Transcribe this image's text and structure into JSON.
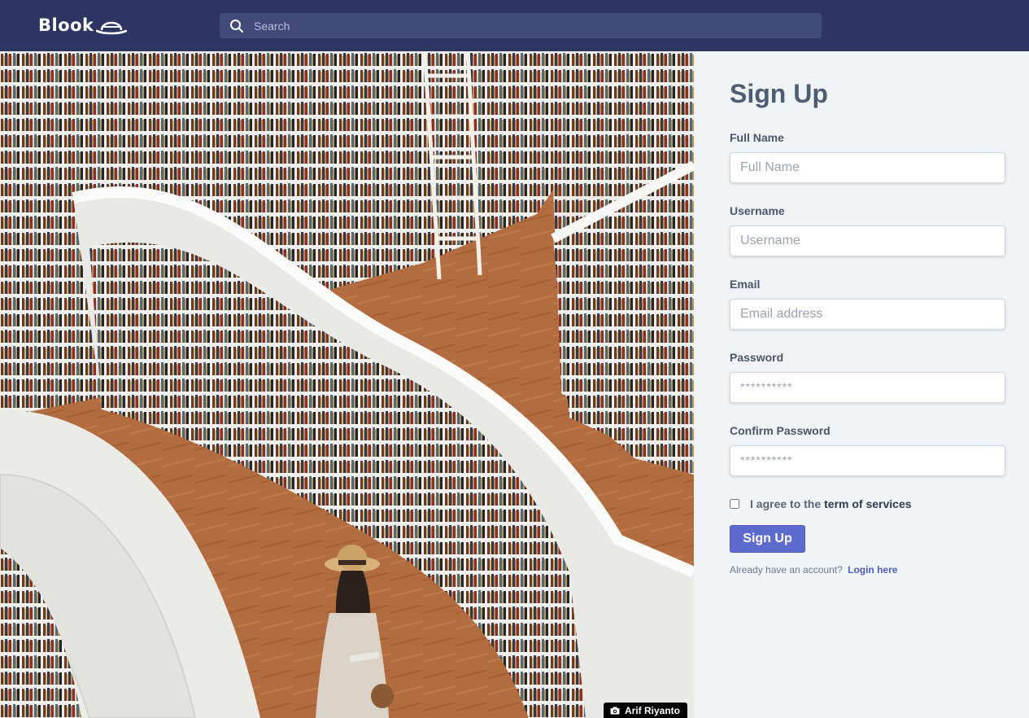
{
  "brand": {
    "name": "Blook",
    "logo_icon": "hat-icon"
  },
  "search": {
    "placeholder": "Search",
    "icon": "search-icon"
  },
  "hero": {
    "credit": "Arif Riyanto",
    "credit_icon": "camera-icon"
  },
  "form": {
    "title": "Sign Up",
    "fields": [
      {
        "label": "Full Name",
        "placeholder": "Full Name"
      },
      {
        "label": "Username",
        "placeholder": "Username"
      },
      {
        "label": "Email",
        "placeholder": "Email address"
      },
      {
        "label": "Password",
        "placeholder": "**********"
      },
      {
        "label": "Confirm Password",
        "placeholder": "**********"
      }
    ],
    "agree_prefix": "I agree to the",
    "agree_link": "term of services",
    "submit_label": "Sign Up",
    "login_prompt": "Already have an account?",
    "login_link": "Login here"
  },
  "colors": {
    "header": "#2e3562",
    "accent": "#5d6bcf",
    "panel": "#f1f4f7"
  }
}
